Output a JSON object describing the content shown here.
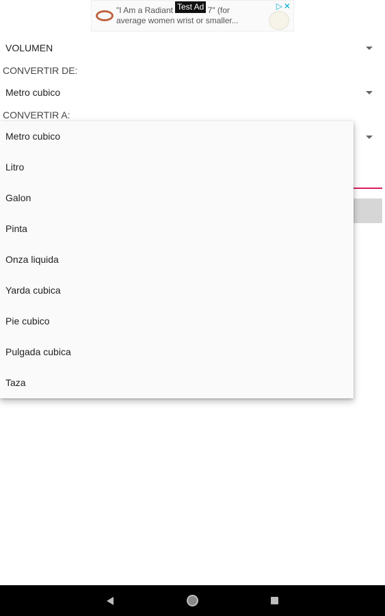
{
  "ad": {
    "label": "Test Ad",
    "line1": "\"I Am a Radiant Bracelet 7\" (for",
    "line2": "average women wrist or smaller..."
  },
  "category_spinner": {
    "value": "VOLUMEN"
  },
  "from_label": "CONVERTIR DE:",
  "from_spinner": {
    "value": "Metro cubico"
  },
  "to_label": "CONVERTIR A:",
  "dropdown": {
    "options": [
      "Metro cubico",
      "Litro",
      "Galon",
      "Pinta",
      "Onza liquida",
      "Yarda cubica",
      "Pie cubico",
      "Pulgada cubica",
      "Taza"
    ]
  },
  "colors": {
    "accent": "#d81b60",
    "button_disabled": "#d6d6d6",
    "navbar": "#000000"
  },
  "icons": {
    "nav_back": "back-triangle-icon",
    "nav_home": "home-circle-icon",
    "nav_recent": "recent-apps-square-icon"
  }
}
